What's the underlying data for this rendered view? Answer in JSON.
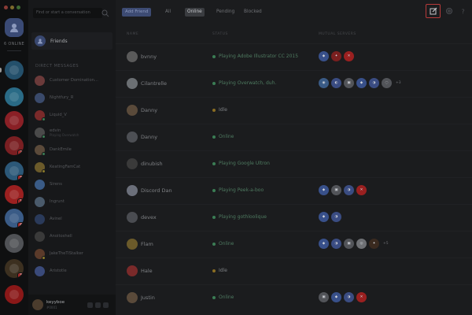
{
  "window": {
    "traffic_colors": [
      "#8a3b36",
      "#7d6b2c",
      "#3d6a34"
    ]
  },
  "rail": {
    "online_label": "6 ONLINE",
    "servers": [
      {
        "color": "#24506b",
        "icon": "swirl-icon",
        "mention": ""
      },
      {
        "color": "#2a6b86",
        "icon": "penguin-icon",
        "mention": ""
      },
      {
        "color": "#8a2026",
        "icon": "flame-icon",
        "mention": ""
      },
      {
        "color": "#7a1f22",
        "icon": "pokeball-icon",
        "mention": "2"
      },
      {
        "color": "#2c5878",
        "icon": "bot-icon",
        "mention": "3"
      },
      {
        "color": "#9b2020",
        "icon": "cross-icon",
        "mention": "1"
      },
      {
        "color": "#3a5b86",
        "icon": "logo-icon",
        "mention": "4"
      },
      {
        "color": "#505256",
        "icon": "circle-icon",
        "mention": ""
      },
      {
        "color": "#3c3020",
        "icon": "portrait-icon",
        "mention": "3"
      },
      {
        "color": "#8a1818",
        "icon": "red-icon",
        "mention": ""
      }
    ]
  },
  "dmlist": {
    "search_placeholder": "Find or start a conversation",
    "friends_label": "Friends",
    "dm_header": "DIRECT MESSAGES",
    "dms": [
      {
        "name": "Customer Domination...",
        "sub": "",
        "color": "#6b3a3a",
        "status": ""
      },
      {
        "name": "Nightfury_R",
        "sub": "",
        "color": "#3a4a6b",
        "status": ""
      },
      {
        "name": "Liquid_V",
        "sub": "",
        "color": "#7a2a2a",
        "status": "#3b7d54"
      },
      {
        "name": "edvin",
        "sub": "Playing Overwatch",
        "color": "#4a4a4a",
        "status": "#3b7d54"
      },
      {
        "name": "DankEmile",
        "sub": "",
        "color": "#5b4a3a",
        "status": "#3b7d54"
      },
      {
        "name": "KeatingFamCat",
        "sub": "",
        "color": "#6b5a2a",
        "status": "#8a7a2a"
      },
      {
        "name": "Sirens",
        "sub": "",
        "color": "#3a5b86",
        "status": ""
      },
      {
        "name": "Ingrunt",
        "sub": "",
        "color": "#4a5a6b",
        "status": ""
      },
      {
        "name": "Avinel",
        "sub": "",
        "color": "#2a3a5a",
        "status": ""
      },
      {
        "name": "Anoitoshell",
        "sub": "",
        "color": "#3a3a3a",
        "status": ""
      },
      {
        "name": "JakeTheTiStalker",
        "sub": "",
        "color": "#5a3a2a",
        "status": "#8a7a2a"
      },
      {
        "name": "Aristotle",
        "sub": "",
        "color": "#3a4a7a",
        "status": ""
      }
    ],
    "user": {
      "name": "keyyboe",
      "tag": "#0001"
    }
  },
  "topbar": {
    "add_friend": "Add Friend",
    "tabs": [
      "All",
      "Online",
      "Pending",
      "Blocked"
    ],
    "active_tab": "Online"
  },
  "columns": {
    "name": "NAME",
    "status": "STATUS",
    "mutual": "MUTUAL SERVERS"
  },
  "friends": [
    {
      "name": "bvnny",
      "status": "Playing Adobe Illustrator CC 2015",
      "state": "online",
      "avatar": "#5a5a5a",
      "mutual": [
        {
          "c": "#38508a",
          "g": "◆"
        },
        {
          "c": "#7a1f1f",
          "g": "✦"
        },
        {
          "c": "#9a2020",
          "g": "✕"
        }
      ],
      "more": ""
    },
    {
      "name": "Cilantrelle",
      "status": "Playing Overwatch, duh.",
      "state": "online",
      "avatar": "#6b6f73",
      "mutual": [
        {
          "c": "#3a5b86",
          "g": "◉"
        },
        {
          "c": "#3a4c82",
          "g": "◐"
        },
        {
          "c": "#525459",
          "g": "▣"
        },
        {
          "c": "#38508a",
          "g": "◆"
        },
        {
          "c": "#3a4c82",
          "g": "◑"
        },
        {
          "c": "#525459",
          "g": "◌"
        }
      ],
      "more": "+3"
    },
    {
      "name": "Danny",
      "status": "Idle",
      "state": "idle",
      "avatar": "#5a4a3a",
      "mutual": [],
      "more": ""
    },
    {
      "name": "Danny",
      "status": "Online",
      "state": "online",
      "avatar": "#4d4f54",
      "mutual": [],
      "more": ""
    },
    {
      "name": "dinubish",
      "status": "Playing Google Ultron",
      "state": "online",
      "avatar": "#3a3a3a",
      "mutual": [],
      "more": ""
    },
    {
      "name": "Discord Dan",
      "status": "Playing Peek-a-boo",
      "state": "online",
      "avatar": "#6b6f7a",
      "mutual": [
        {
          "c": "#38508a",
          "g": "◆"
        },
        {
          "c": "#525459",
          "g": "▣"
        },
        {
          "c": "#3a4c82",
          "g": "◑"
        },
        {
          "c": "#9a2020",
          "g": "✕"
        }
      ],
      "more": ""
    },
    {
      "name": "devex",
      "status": "Playing gothloolique",
      "state": "online",
      "avatar": "#4a4c51",
      "mutual": [
        {
          "c": "#38508a",
          "g": "◆"
        },
        {
          "c": "#3a4c82",
          "g": "◑"
        }
      ],
      "more": ""
    },
    {
      "name": "Flam",
      "status": "Online",
      "state": "online",
      "avatar": "#6b5a2a",
      "mutual": [
        {
          "c": "#38508a",
          "g": "◆"
        },
        {
          "c": "#3a4c82",
          "g": "◑"
        },
        {
          "c": "#525459",
          "g": "▣"
        },
        {
          "c": "#6e7074",
          "g": "◎"
        },
        {
          "c": "#3a2a1f",
          "g": "✦"
        }
      ],
      "more": "+5"
    },
    {
      "name": "Hale",
      "status": "Idle",
      "state": "idle",
      "avatar": "#7a2a2a",
      "mutual": [],
      "more": ""
    },
    {
      "name": "Justin",
      "status": "Online",
      "state": "online",
      "avatar": "#5a4a3a",
      "mutual": [
        {
          "c": "#525459",
          "g": "▣"
        },
        {
          "c": "#38508a",
          "g": "◆"
        },
        {
          "c": "#3a4c82",
          "g": "◑"
        },
        {
          "c": "#9a2020",
          "g": "✕"
        }
      ],
      "more": ""
    }
  ],
  "colors": {
    "online": "#3b7d54",
    "idle": "#8a6d22",
    "compose_border": "#b73a3a"
  }
}
